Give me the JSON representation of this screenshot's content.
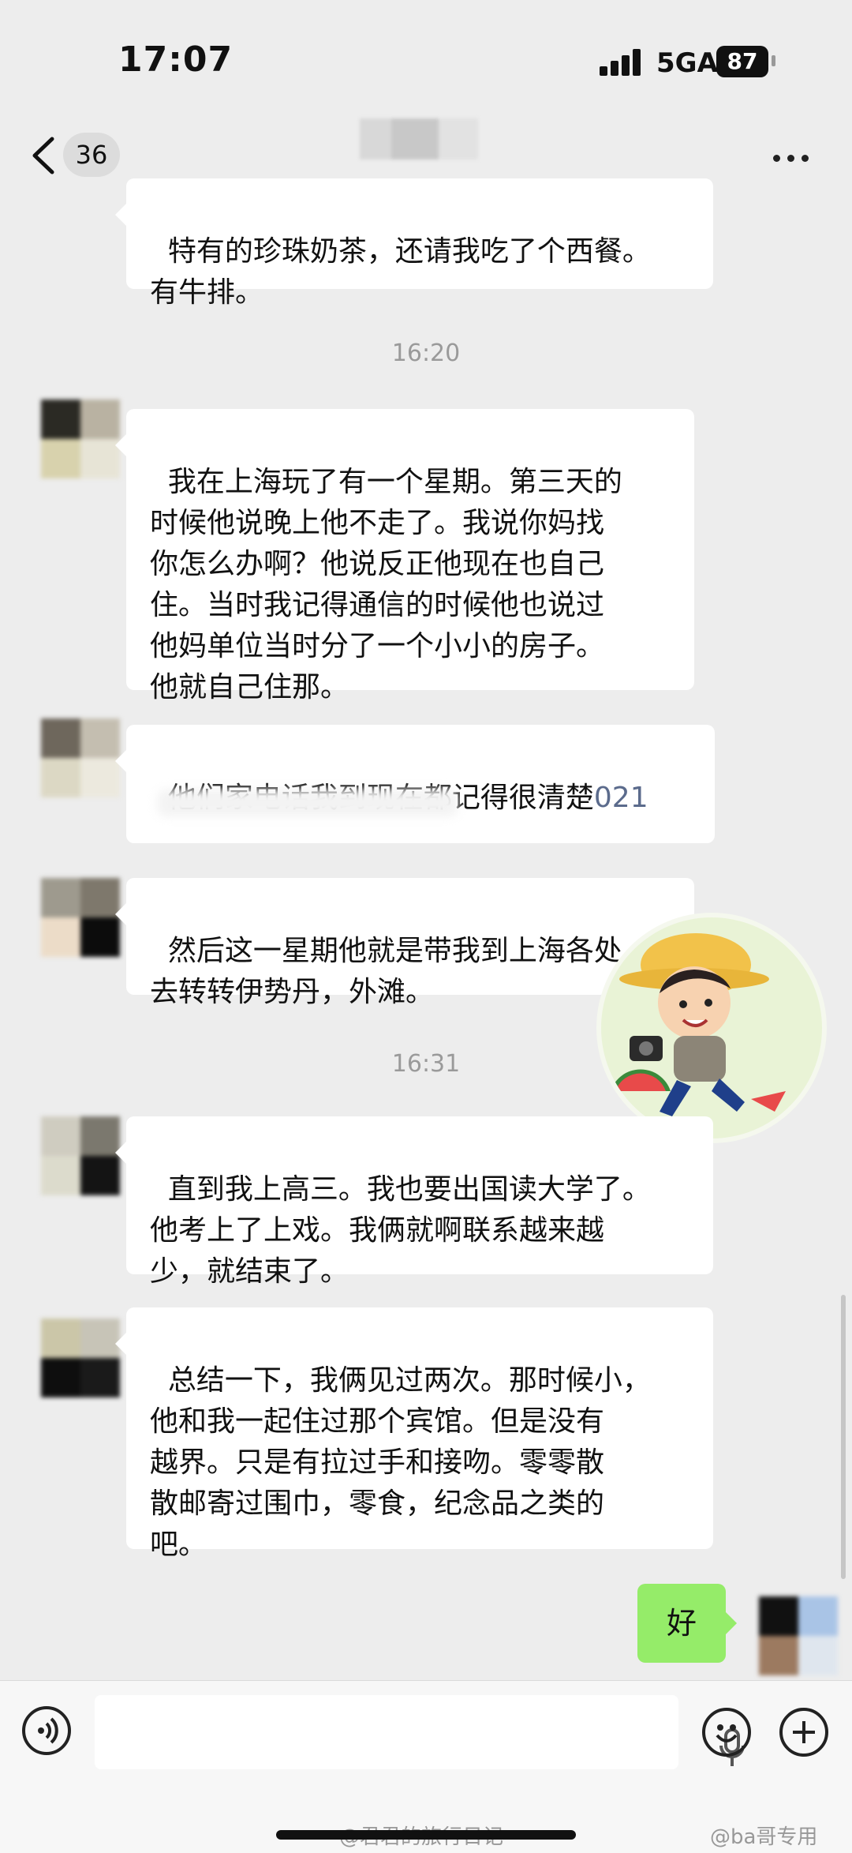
{
  "status_bar": {
    "time": "17:07",
    "network": "5GA",
    "battery": "87"
  },
  "header": {
    "unread_count": "36"
  },
  "messages": [
    {
      "text": "特有的珍珠奶茶，还请我吃了个西餐。\n有牛排。"
    },
    {
      "text": "我在上海玩了有一个星期。第三天的\n时候他说晚上他不走了。我说你妈找\n你怎么办啊？他说反正他现在也自己\n住。当时我记得通信的时候他也说过\n他妈单位当时分了一个小小的房子。\n他就自己住那。"
    },
    {
      "text": "他们家电话我到现在都记得很清楚",
      "phone": "021"
    },
    {
      "text": "然后这一星期他就是带我到上海各处\n去转转伊势丹，外滩。"
    },
    {
      "text": "直到我上高三。我也要出国读大学了。\n他考上了上戏。我俩就啊联系越来越\n少，就结束了。"
    },
    {
      "text": "总结一下，我俩见过两次。那时候小，\n他和我一起住过那个宾馆。但是没有\n越界。只是有拉过手和接吻。零零散\n散邮寄过围巾，零食，纪念品之类的\n吧。"
    }
  ],
  "timestamps": [
    "16:20",
    "16:31"
  ],
  "my_message": {
    "text": "好"
  },
  "watermarks": {
    "left": "@君君的旅行日记",
    "right": "@ba哥专用"
  },
  "colors": {
    "background": "#ededed",
    "bubble_other": "#ffffff",
    "bubble_mine": "#95ec69",
    "timestamp": "#9a9a9a"
  }
}
